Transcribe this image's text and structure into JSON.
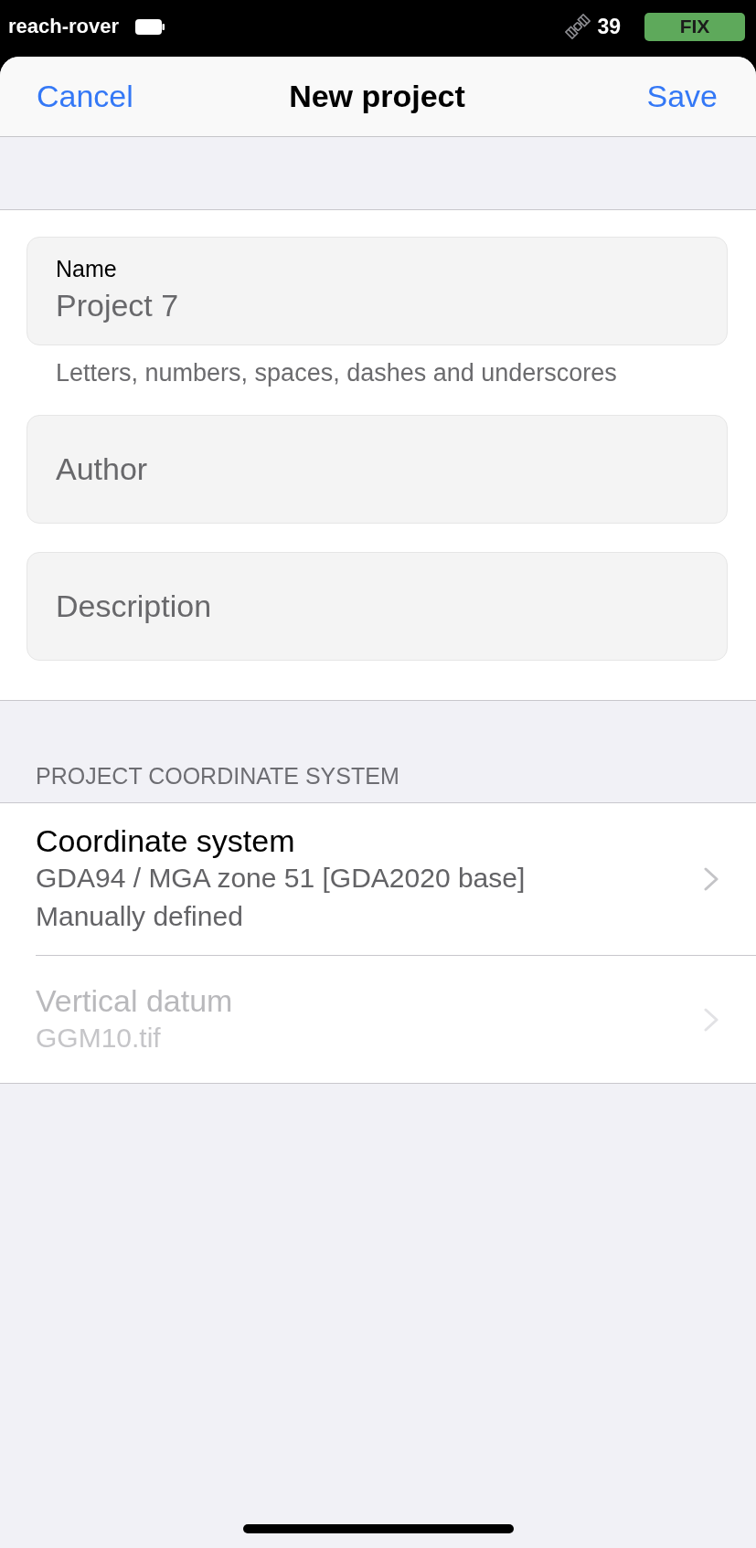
{
  "status_bar": {
    "device": "reach-rover",
    "satellites": "39",
    "fix_status": "FIX"
  },
  "nav_bar": {
    "cancel": "Cancel",
    "title": "New project",
    "save": "Save"
  },
  "form": {
    "fields": [
      {
        "label": "Name",
        "value": "Project 7",
        "hint": "Letters, numbers, spaces, dashes and underscores"
      },
      {
        "placeholder": "Author"
      },
      {
        "placeholder": "Description"
      }
    ]
  },
  "coordinate_section": {
    "header": "PROJECT COORDINATE SYSTEM",
    "rows": [
      {
        "title": "Coordinate system",
        "details": [
          "GDA94 / MGA zone 51 [GDA2020 base]",
          "Manually defined"
        ],
        "disabled": false
      },
      {
        "title": "Vertical datum",
        "details": [
          "GGM10.tif"
        ],
        "disabled": true
      }
    ]
  }
}
